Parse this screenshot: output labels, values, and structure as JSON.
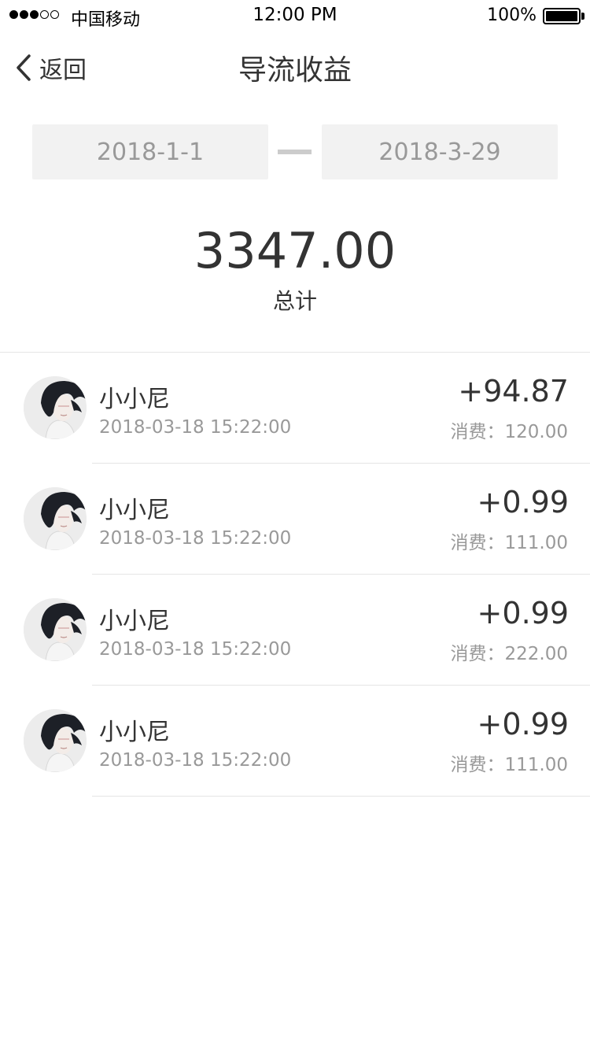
{
  "status_bar": {
    "carrier": "中国移动",
    "time": "12:00 PM",
    "battery": "100%",
    "signal_bars_filled": 3,
    "signal_bars_total": 5
  },
  "nav": {
    "back_label": "返回",
    "title": "导流收益"
  },
  "date_range": {
    "start": "2018-1-1",
    "end": "2018-3-29"
  },
  "summary": {
    "total": "3347.00",
    "label": "总计"
  },
  "records": [
    {
      "name": "小小尼",
      "time": "2018-03-18 15:22:00",
      "amount": "+94.87",
      "spend": "消费：120.00"
    },
    {
      "name": "小小尼",
      "time": "2018-03-18 15:22:00",
      "amount": "+0.99",
      "spend": "消费：111.00"
    },
    {
      "name": "小小尼",
      "time": "2018-03-18 15:22:00",
      "amount": "+0.99",
      "spend": "消费：222.00"
    },
    {
      "name": "小小尼",
      "time": "2018-03-18 15:22:00",
      "amount": "+0.99",
      "spend": "消费：111.00"
    }
  ],
  "icons": {
    "back": "chevron-left-icon",
    "avatar": "user-avatar-illustration",
    "battery": "battery-icon",
    "signal": "signal-dots-icon"
  }
}
